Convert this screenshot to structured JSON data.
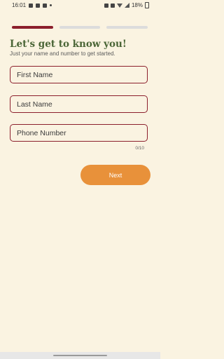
{
  "status_bar": {
    "time": "16:01",
    "battery": "18%",
    "icons": [
      "usb-icon",
      "image-icon",
      "video-icon",
      "dot-icon",
      "alarm-icon",
      "mute-icon",
      "wifi-icon",
      "signal-icon",
      "battery-icon"
    ]
  },
  "progress": {
    "steps_total": 3,
    "current_step": 1
  },
  "header": {
    "title": "Let's get to know you!",
    "subtitle": "Just your name and number to get started."
  },
  "form": {
    "first_name": {
      "placeholder": "First Name",
      "value": ""
    },
    "last_name": {
      "placeholder": "Last Name",
      "value": ""
    },
    "phone": {
      "placeholder": "Phone Number",
      "value": "",
      "counter": "0/10"
    }
  },
  "actions": {
    "next_label": "Next"
  },
  "colors": {
    "background": "#faf3e1",
    "accent_primary": "#8c1f2c",
    "title_green": "#4a6536",
    "button_orange": "#e8913a",
    "inactive_step": "#dcdcdc"
  }
}
